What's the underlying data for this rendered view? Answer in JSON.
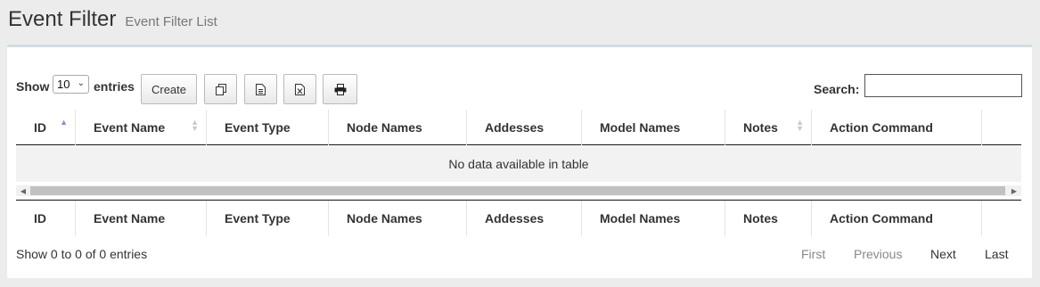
{
  "header": {
    "title": "Event Filter",
    "subtitle": "Event Filter List"
  },
  "length_control": {
    "label_before": "Show",
    "selected": "10",
    "label_after": "entries"
  },
  "toolbar": {
    "create_label": "Create",
    "buttons": [
      {
        "name": "copy",
        "icon": "copy-icon"
      },
      {
        "name": "csv",
        "icon": "csv-file-icon"
      },
      {
        "name": "excel",
        "icon": "excel-file-icon"
      },
      {
        "name": "print",
        "icon": "print-icon"
      }
    ]
  },
  "search": {
    "label": "Search:",
    "value": "",
    "placeholder": ""
  },
  "table": {
    "columns": [
      "ID",
      "Event Name",
      "Event Type",
      "Node Names",
      "Addesses",
      "Model Names",
      "Notes",
      "Action Command"
    ],
    "sorted_column": "ID",
    "sort_direction": "asc",
    "empty_message": "No data available in table"
  },
  "info": "Show 0 to 0 of 0 entries",
  "pagination": {
    "first": "First",
    "previous": "Previous",
    "next": "Next",
    "last": "Last"
  },
  "colors": {
    "sort_active": "#8c8ccc",
    "panel_border": "#d2dce4",
    "page_bg": "#ececec"
  }
}
